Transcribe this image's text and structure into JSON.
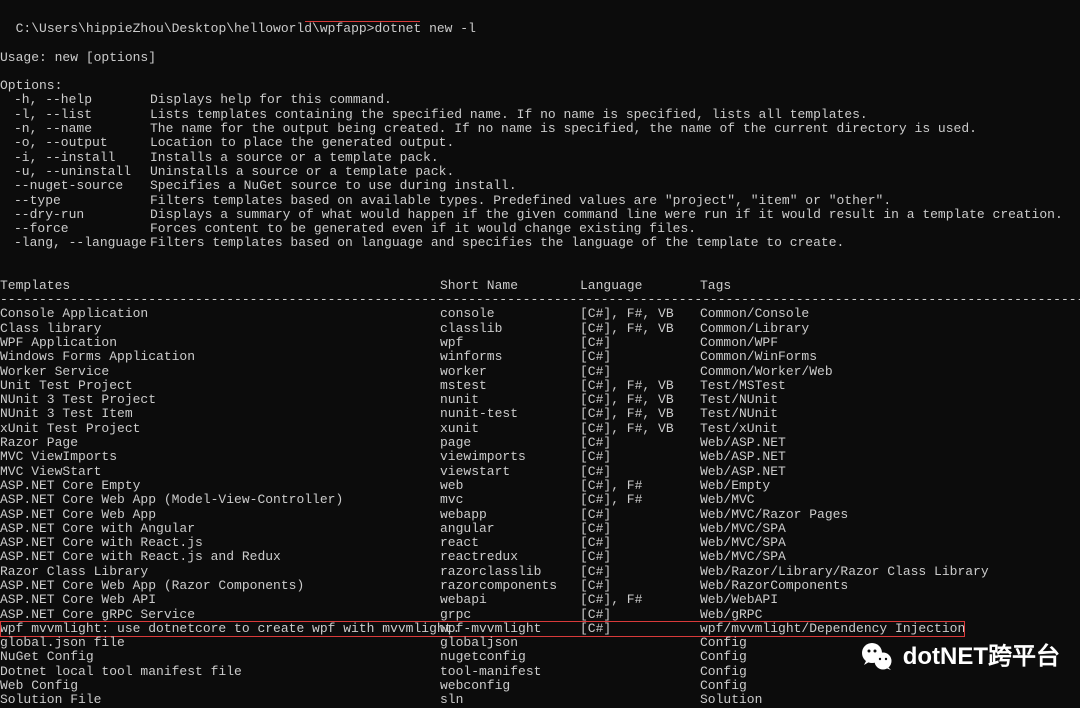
{
  "prompt": {
    "path": "C:\\Users\\hippieZhou\\Desktop\\helloworld\\wpfapp>",
    "command": "dotnet new -l"
  },
  "usage": "Usage: new [options]",
  "options_header": "Options:",
  "options": [
    {
      "flag": "-h, --help",
      "desc": "Displays help for this command."
    },
    {
      "flag": "-l, --list",
      "desc": "Lists templates containing the specified name. If no name is specified, lists all templates."
    },
    {
      "flag": "-n, --name",
      "desc": "The name for the output being created. If no name is specified, the name of the current directory is used."
    },
    {
      "flag": "-o, --output",
      "desc": "Location to place the generated output."
    },
    {
      "flag": "-i, --install",
      "desc": "Installs a source or a template pack."
    },
    {
      "flag": "-u, --uninstall",
      "desc": "Uninstalls a source or a template pack."
    },
    {
      "flag": "--nuget-source",
      "desc": "Specifies a NuGet source to use during install."
    },
    {
      "flag": "--type",
      "desc": "Filters templates based on available types. Predefined values are \"project\", \"item\" or \"other\"."
    },
    {
      "flag": "--dry-run",
      "desc": "Displays a summary of what would happen if the given command line were run if it would result in a template creation."
    },
    {
      "flag": "--force",
      "desc": "Forces content to be generated even if it would change existing files."
    },
    {
      "flag": "-lang, --language",
      "desc": "Filters templates based on language and specifies the language of the template to create."
    }
  ],
  "table_headers": {
    "templates": "Templates",
    "short_name": "Short Name",
    "language": "Language",
    "tags": "Tags"
  },
  "dashes": "----------------------------------------------------------------------------------------------------------------------------------------------------------------------------------------------------------------",
  "templates": [
    {
      "name": "Console Application",
      "short": "console",
      "lang": "[C#], F#, VB",
      "tags": "Common/Console"
    },
    {
      "name": "Class library",
      "short": "classlib",
      "lang": "[C#], F#, VB",
      "tags": "Common/Library"
    },
    {
      "name": "WPF Application",
      "short": "wpf",
      "lang": "[C#]",
      "tags": "Common/WPF"
    },
    {
      "name": "Windows Forms Application",
      "short": "winforms",
      "lang": "[C#]",
      "tags": "Common/WinForms"
    },
    {
      "name": "Worker Service",
      "short": "worker",
      "lang": "[C#]",
      "tags": "Common/Worker/Web"
    },
    {
      "name": "Unit Test Project",
      "short": "mstest",
      "lang": "[C#], F#, VB",
      "tags": "Test/MSTest"
    },
    {
      "name": "NUnit 3 Test Project",
      "short": "nunit",
      "lang": "[C#], F#, VB",
      "tags": "Test/NUnit"
    },
    {
      "name": "NUnit 3 Test Item",
      "short": "nunit-test",
      "lang": "[C#], F#, VB",
      "tags": "Test/NUnit"
    },
    {
      "name": "xUnit Test Project",
      "short": "xunit",
      "lang": "[C#], F#, VB",
      "tags": "Test/xUnit"
    },
    {
      "name": "Razor Page",
      "short": "page",
      "lang": "[C#]",
      "tags": "Web/ASP.NET"
    },
    {
      "name": "MVC ViewImports",
      "short": "viewimports",
      "lang": "[C#]",
      "tags": "Web/ASP.NET"
    },
    {
      "name": "MVC ViewStart",
      "short": "viewstart",
      "lang": "[C#]",
      "tags": "Web/ASP.NET"
    },
    {
      "name": "ASP.NET Core Empty",
      "short": "web",
      "lang": "[C#], F#",
      "tags": "Web/Empty"
    },
    {
      "name": "ASP.NET Core Web App (Model-View-Controller)",
      "short": "mvc",
      "lang": "[C#], F#",
      "tags": "Web/MVC"
    },
    {
      "name": "ASP.NET Core Web App",
      "short": "webapp",
      "lang": "[C#]",
      "tags": "Web/MVC/Razor Pages"
    },
    {
      "name": "ASP.NET Core with Angular",
      "short": "angular",
      "lang": "[C#]",
      "tags": "Web/MVC/SPA"
    },
    {
      "name": "ASP.NET Core with React.js",
      "short": "react",
      "lang": "[C#]",
      "tags": "Web/MVC/SPA"
    },
    {
      "name": "ASP.NET Core with React.js and Redux",
      "short": "reactredux",
      "lang": "[C#]",
      "tags": "Web/MVC/SPA"
    },
    {
      "name": "Razor Class Library",
      "short": "razorclasslib",
      "lang": "[C#]",
      "tags": "Web/Razor/Library/Razor Class Library"
    },
    {
      "name": "ASP.NET Core Web App (Razor Components)",
      "short": "razorcomponents",
      "lang": "[C#]",
      "tags": "Web/RazorComponents"
    },
    {
      "name": "ASP.NET Core Web API",
      "short": "webapi",
      "lang": "[C#], F#",
      "tags": "Web/WebAPI"
    },
    {
      "name": "ASP.NET Core gRPC Service",
      "short": "grpc",
      "lang": "[C#]",
      "tags": "Web/gRPC"
    },
    {
      "name": "wpf mvvmlight: use dotnetcore to create wpf with mvvmlight.",
      "short": "wpf-mvvmlight",
      "lang": "[C#]",
      "tags": "wpf/mvvmlight/Dependency Injection",
      "highlight": true
    },
    {
      "name": "global.json file",
      "short": "globaljson",
      "lang": "",
      "tags": "Config"
    },
    {
      "name": "NuGet Config",
      "short": "nugetconfig",
      "lang": "",
      "tags": "Config"
    },
    {
      "name": "Dotnet local tool manifest file",
      "short": "tool-manifest",
      "lang": "",
      "tags": "Config"
    },
    {
      "name": "Web Config",
      "short": "webconfig",
      "lang": "",
      "tags": "Config"
    },
    {
      "name": "Solution File",
      "short": "sln",
      "lang": "",
      "tags": "Solution"
    }
  ],
  "watermark": {
    "text": "dotNET跨平台"
  }
}
